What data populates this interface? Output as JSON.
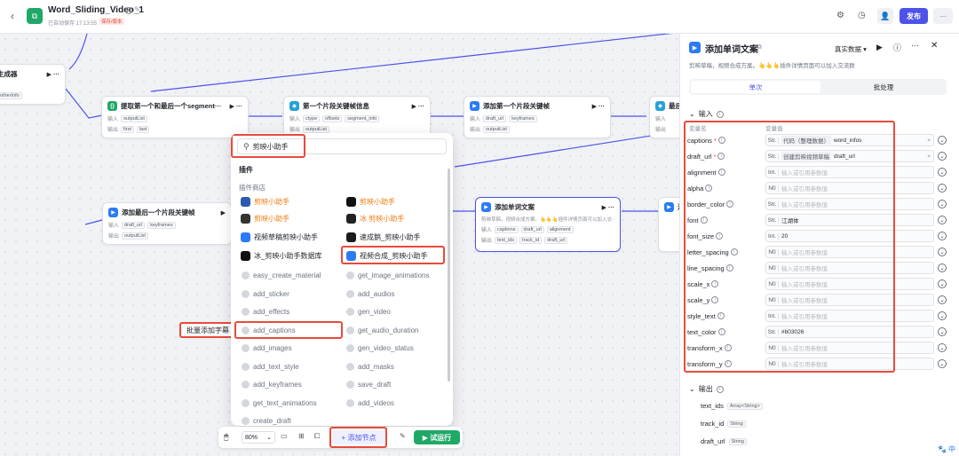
{
  "topbar": {
    "back_icon": "chevron-left-icon",
    "app_title": "Word_Sliding_Video_1",
    "autosave": "已自动保存 17:13:55",
    "version_badge": "保存/版本",
    "publish": "发布"
  },
  "nodes": {
    "n0": {
      "title": "生成器",
      "out": "otherInfo"
    },
    "n1": {
      "title": "提取第一个和最后一个segment···",
      "in_label": "输入",
      "in_tags": [
        "outputList"
      ],
      "out_label": "输出",
      "out_tags": [
        "first",
        "last"
      ]
    },
    "n2": {
      "title": "第一个片段关键帧信息",
      "in_label": "输入",
      "in_tags": [
        "ctype",
        "offsets",
        "segment_info"
      ],
      "out_label": "输出",
      "out_tags": [
        "outputList"
      ]
    },
    "n3": {
      "title": "添加第一个片段关键帧",
      "in_label": "输入",
      "in_tags": [
        "draft_url",
        "keyframes"
      ],
      "out_label": "输出",
      "out_tags": [
        "outputList"
      ]
    },
    "n4": {
      "title": "最后一",
      "in_label": "输入",
      "out_label": "输出"
    },
    "n5": {
      "title": "添加最后一个片段关键帧",
      "in_label": "输入",
      "in_tags": [
        "draft_url",
        "keyframes"
      ],
      "out_label": "输出",
      "out_tags": [
        "outputList"
      ]
    },
    "n6": {
      "title": "添加单词文案",
      "desc": "剪映草稿，视频合成方案。👆👆👆插件详情页面可以加入交···",
      "in_label": "输入",
      "in_tags": [
        "captions",
        "draft_url",
        "alignment"
      ],
      "out_label": "输出",
      "out_tags": [
        "text_ids",
        "track_id",
        "draft_url"
      ]
    },
    "n7": {
      "title": "添"
    }
  },
  "popup": {
    "search_value": "剪映小助手",
    "section_plugins": "插件",
    "section_store": "插件商店",
    "plugins": [
      {
        "label": "剪映小助手",
        "color": "orange"
      },
      {
        "label": "剪映小助手",
        "color": "orange"
      },
      {
        "label": "剪映小助手",
        "color": "orange"
      },
      {
        "label": "冰 剪映小助手",
        "color": "orange"
      },
      {
        "label": "视频草稿剪映小助手",
        "color": "dark"
      },
      {
        "label": "速成鹅_剪映小助手",
        "color": "dark"
      },
      {
        "label": "冰_剪映小助手数据库",
        "color": "dark"
      },
      {
        "label": "视频合成_剪映小助手",
        "color": "dark"
      }
    ],
    "tools": [
      "easy_create_material",
      "get_image_animations",
      "add_sticker",
      "add_audios",
      "add_effects",
      "gen_video",
      "add_captions",
      "get_audio_duration",
      "add_images",
      "gen_video_status",
      "add_text_style",
      "add_masks",
      "add_keyframes",
      "save_draft",
      "get_text_animations",
      "add_videos",
      "create_draft",
      ""
    ],
    "tooltip": "批量添加字幕"
  },
  "bottom_toolbar": {
    "zoom": "80%",
    "add_node": "添加节点",
    "test_run": "试运行"
  },
  "panel": {
    "title": "添加单词文案",
    "data_mode": "真实数据",
    "desc": "剪映草稿，视频合成方案。👆👆👆插件详情页面可以加入交流群",
    "tab_single": "单次",
    "tab_batch": "批处理",
    "input_section": "输入",
    "col_name": "变量名",
    "col_value": "变量值",
    "params": [
      {
        "name": "captions",
        "req": true,
        "type": "Str.",
        "value_tag": "代码（整理数据）",
        "value": "word_infos",
        "clear": true
      },
      {
        "name": "draft_url",
        "req": true,
        "type": "Str.",
        "value_tag": "创建剪映视频草稿",
        "value": "draft_url",
        "clear": true
      },
      {
        "name": "alignment",
        "req": false,
        "type": "Int.",
        "placeholder": "输入或引用参数值"
      },
      {
        "name": "alpha",
        "req": false,
        "type": "N0",
        "placeholder": "输入或引用参数值"
      },
      {
        "name": "border_color",
        "req": false,
        "type": "Str.",
        "placeholder": "输入或引用参数值"
      },
      {
        "name": "font",
        "req": false,
        "type": "Str.",
        "value": "江湖体"
      },
      {
        "name": "font_size",
        "req": false,
        "type": "Int.",
        "value": "20"
      },
      {
        "name": "letter_spacing",
        "req": false,
        "type": "N0",
        "placeholder": "输入或引用参数值"
      },
      {
        "name": "line_spacing",
        "req": false,
        "type": "N0",
        "placeholder": "输入或引用参数值"
      },
      {
        "name": "scale_x",
        "req": false,
        "type": "N0",
        "placeholder": "输入或引用参数值"
      },
      {
        "name": "scale_y",
        "req": false,
        "type": "N0",
        "placeholder": "输入或引用参数值"
      },
      {
        "name": "style_text",
        "req": false,
        "type": "Int.",
        "placeholder": "输入或引用参数值"
      },
      {
        "name": "text_color",
        "req": false,
        "type": "Str.",
        "value": "#b03026"
      },
      {
        "name": "transform_x",
        "req": false,
        "type": "N0",
        "placeholder": "输入或引用参数值"
      },
      {
        "name": "transform_y",
        "req": false,
        "type": "N0",
        "placeholder": "输入或引用参数值"
      }
    ],
    "output_section": "输出",
    "outputs": [
      {
        "name": "text_ids",
        "type": "Array<String>"
      },
      {
        "name": "track_id",
        "type": "String"
      },
      {
        "name": "draft_url",
        "type": "String"
      }
    ]
  },
  "corner_badge": "中",
  "colors": {
    "accent": "#4d53e8",
    "run": "#20a867",
    "highlight": "#e84a3b",
    "plugin_orange": "#f07b0e"
  }
}
